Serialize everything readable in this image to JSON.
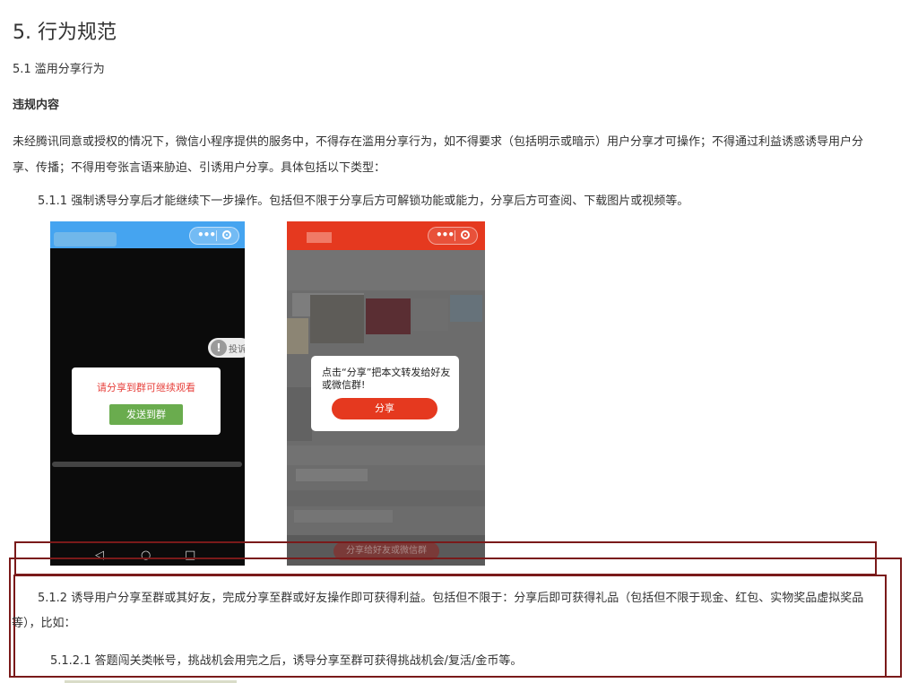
{
  "heading": "5. 行为规范",
  "sub_heading": "5.1 滥用分享行为",
  "section_label": "违规内容",
  "intro_paragraph": "未经腾讯同意或授权的情况下，微信小程序提供的服务中，不得存在滥用分享行为，如不得要求（包括明示或暗示）用户分享才可操作；不得通过利益诱惑诱导用户分享、传播；不得用夸张言语来胁迫、引诱用户分享。具体包括以下类型：",
  "item_511": "5.1.1 强制诱导分享后才能继续下一步操作。包括但不限于分享后方可解锁功能或能力，分享后方可查阅、下载图片或视频等。",
  "phone1": {
    "report_label": "投诉",
    "dialog_message": "请分享到群可继续观看",
    "dialog_button": "发送到群",
    "accent_color": "#45a4f0"
  },
  "phone2": {
    "dialog_message": "点击“分享”把本文转发给好友或微信群!",
    "dialog_button": "分享",
    "bottom_button": "分享给好友或微信群",
    "accent_color": "#e5391f"
  },
  "item_512": "5.1.2 诱导用户分享至群或其好友，完成分享至群或好友操作即可获得利益。包括但不限于：分享后即可获得礼品（包括但不限于现金、红包、实物奖品虚拟奖品等），比如：",
  "item_5121": "5.1.2.1 答题闯关类帐号，挑战机会用完之后，诱导分享至群可获得挑战机会/复活/金币等。",
  "highlight_color": "#7a1a1a"
}
